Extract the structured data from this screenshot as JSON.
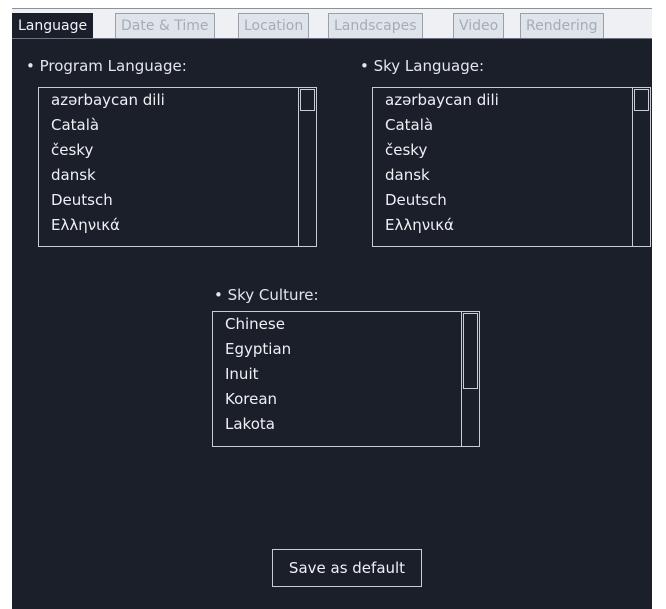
{
  "tabs": [
    {
      "label": "Language",
      "active": true
    },
    {
      "label": "Date & Time",
      "active": false
    },
    {
      "label": "Location",
      "active": false
    },
    {
      "label": "Landscapes",
      "active": false
    },
    {
      "label": "Video",
      "active": false
    },
    {
      "label": "Rendering",
      "active": false
    }
  ],
  "program_language": {
    "label": "• Program Language:",
    "items": [
      "azərbaycan dili",
      "Català",
      "česky",
      "dansk",
      "Deutsch",
      "Ελληνικά"
    ]
  },
  "sky_language": {
    "label": "• Sky Language:",
    "items": [
      "azərbaycan dili",
      "Català",
      "česky",
      "dansk",
      "Deutsch",
      "Ελληνικά"
    ]
  },
  "sky_culture": {
    "label": "• Sky Culture:",
    "items": [
      "Chinese",
      "Egyptian",
      "Inuit",
      "Korean",
      "Lakota"
    ]
  },
  "save_button": "Save as default",
  "colors": {
    "panel_background": "#1b1f2a",
    "tab_inactive_text": "#a6acb6",
    "border": "#c8ccd4"
  }
}
